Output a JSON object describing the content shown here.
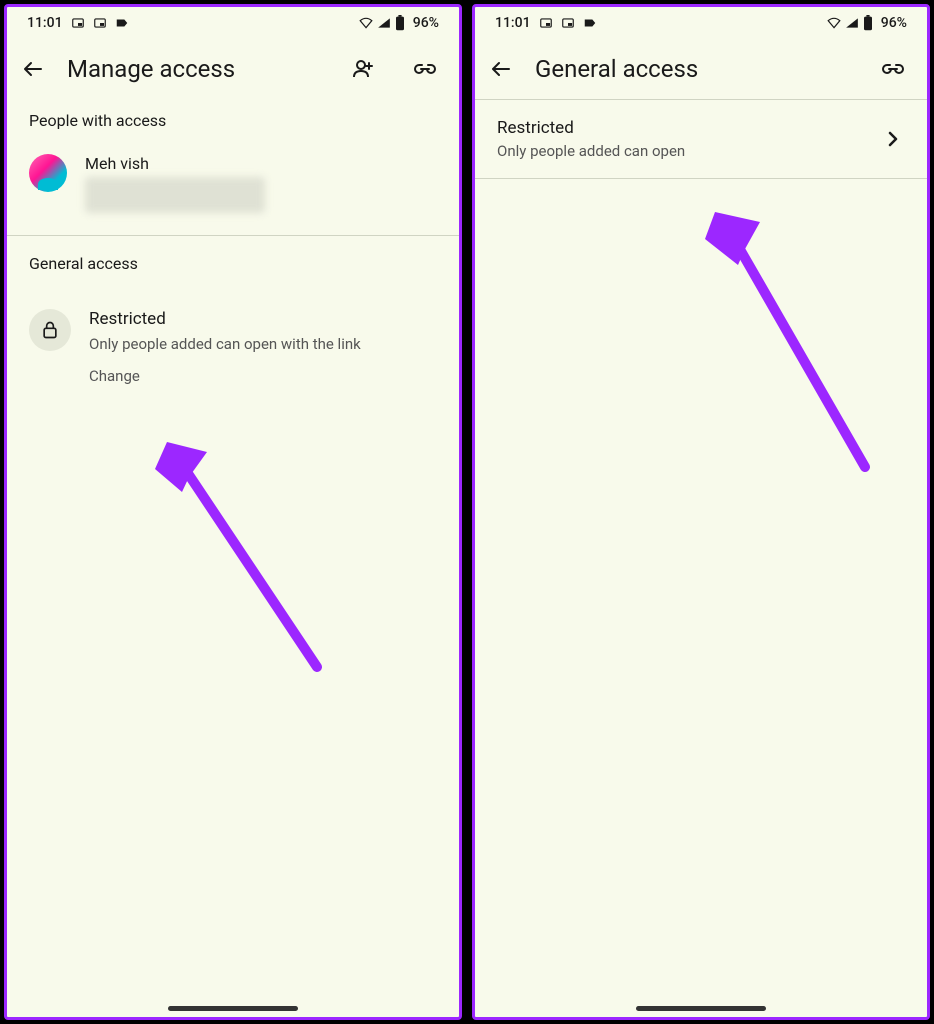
{
  "status": {
    "time": "11:01",
    "battery": "96%"
  },
  "screen1": {
    "title": "Manage access",
    "sections": {
      "people": {
        "header": "People with access",
        "user": {
          "name": "Meh vish"
        }
      },
      "general": {
        "header": "General access",
        "item": {
          "title": "Restricted",
          "desc": "Only people added can open with the link",
          "action": "Change"
        }
      }
    }
  },
  "screen2": {
    "title": "General access",
    "item": {
      "title": "Restricted",
      "desc": "Only people added can open"
    }
  }
}
